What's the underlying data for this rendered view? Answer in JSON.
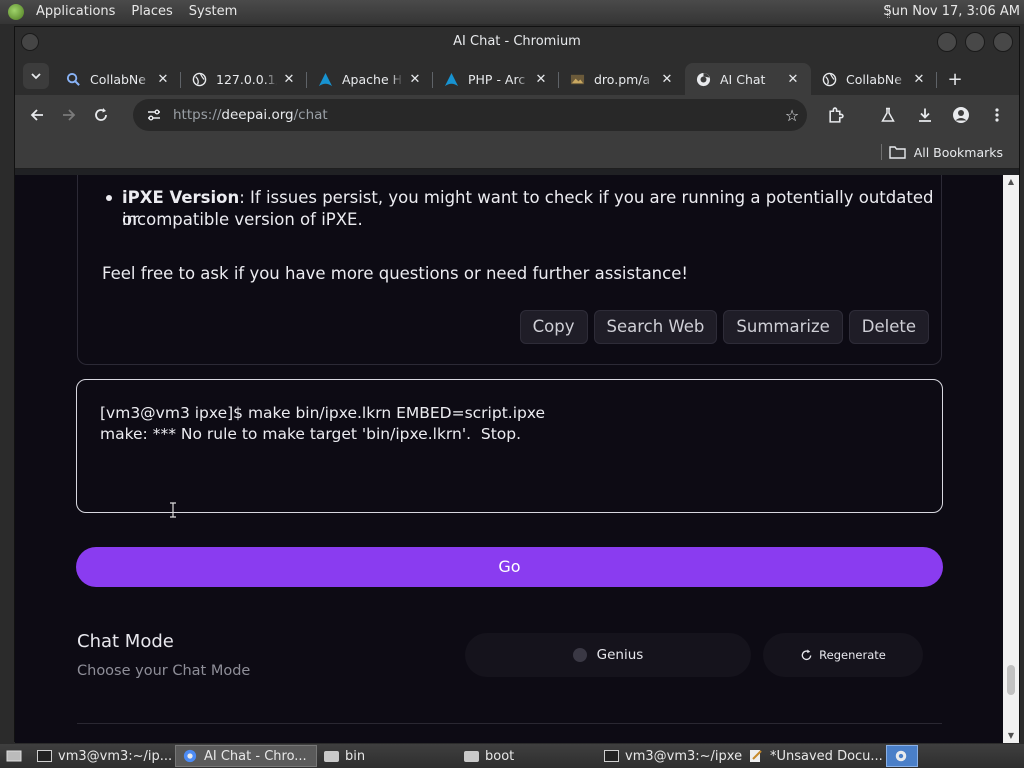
{
  "top_panel": {
    "menus": [
      "Applications",
      "Places",
      "System"
    ],
    "clock": "Sun Nov 17,  3:06 AM"
  },
  "window": {
    "title": "AI Chat - Chromium"
  },
  "tabs": [
    {
      "title": "CollabNe",
      "icon": "search-icon",
      "active": false
    },
    {
      "title": "127.0.0.1/",
      "icon": "globe-icon",
      "active": false
    },
    {
      "title": "Apache H",
      "icon": "arch-icon",
      "active": false
    },
    {
      "title": "PHP - Arc",
      "icon": "arch-icon",
      "active": false
    },
    {
      "title": "dro.pm/a",
      "icon": "image-icon",
      "active": false
    },
    {
      "title": "AI Chat",
      "icon": "chromium-icon",
      "active": true
    },
    {
      "title": "CollabNe",
      "icon": "globe-icon",
      "active": false
    }
  ],
  "toolbar": {
    "url_prefix": "https://",
    "url_host": "deepai.org",
    "url_path": "/chat"
  },
  "bookmarks": {
    "all_label": "All Bookmarks"
  },
  "chat": {
    "bullet_title": "iPXE Version",
    "bullet_line1": ": If issues persist, you might want to check if you are running a potentially outdated or",
    "bullet_line2": "incompatible version of iPXE.",
    "closing": "Feel free to ask if you have more questions or need further assistance!",
    "actions": [
      "Copy",
      "Search Web",
      "Summarize",
      "Delete"
    ],
    "input_line1": "[vm3@vm3 ipxe]$ make bin/ipxe.lkrn EMBED=script.ipxe",
    "input_line2": "make: *** No rule to make target 'bin/ipxe.lkrn'.  Stop.",
    "go_label": "Go",
    "mode_title": "Chat Mode",
    "mode_subtitle": "Choose your Chat Mode",
    "genius_label": "Genius",
    "regenerate_label": "Regenerate"
  },
  "taskbar": {
    "items": [
      {
        "label": "vm3@vm3:~/ip...",
        "icon": "terminal-icon",
        "active": false
      },
      {
        "label": "AI Chat - Chro...",
        "icon": "chromium-icon",
        "active": true
      },
      {
        "label": "bin",
        "icon": "folder-icon",
        "active": false
      },
      {
        "label": "boot",
        "icon": "folder-icon",
        "active": false
      },
      {
        "label": "vm3@vm3:~/ipxe",
        "icon": "terminal-icon",
        "active": false
      },
      {
        "label": "*Unsaved Docu...",
        "icon": "text-editor-icon",
        "active": false
      }
    ]
  }
}
